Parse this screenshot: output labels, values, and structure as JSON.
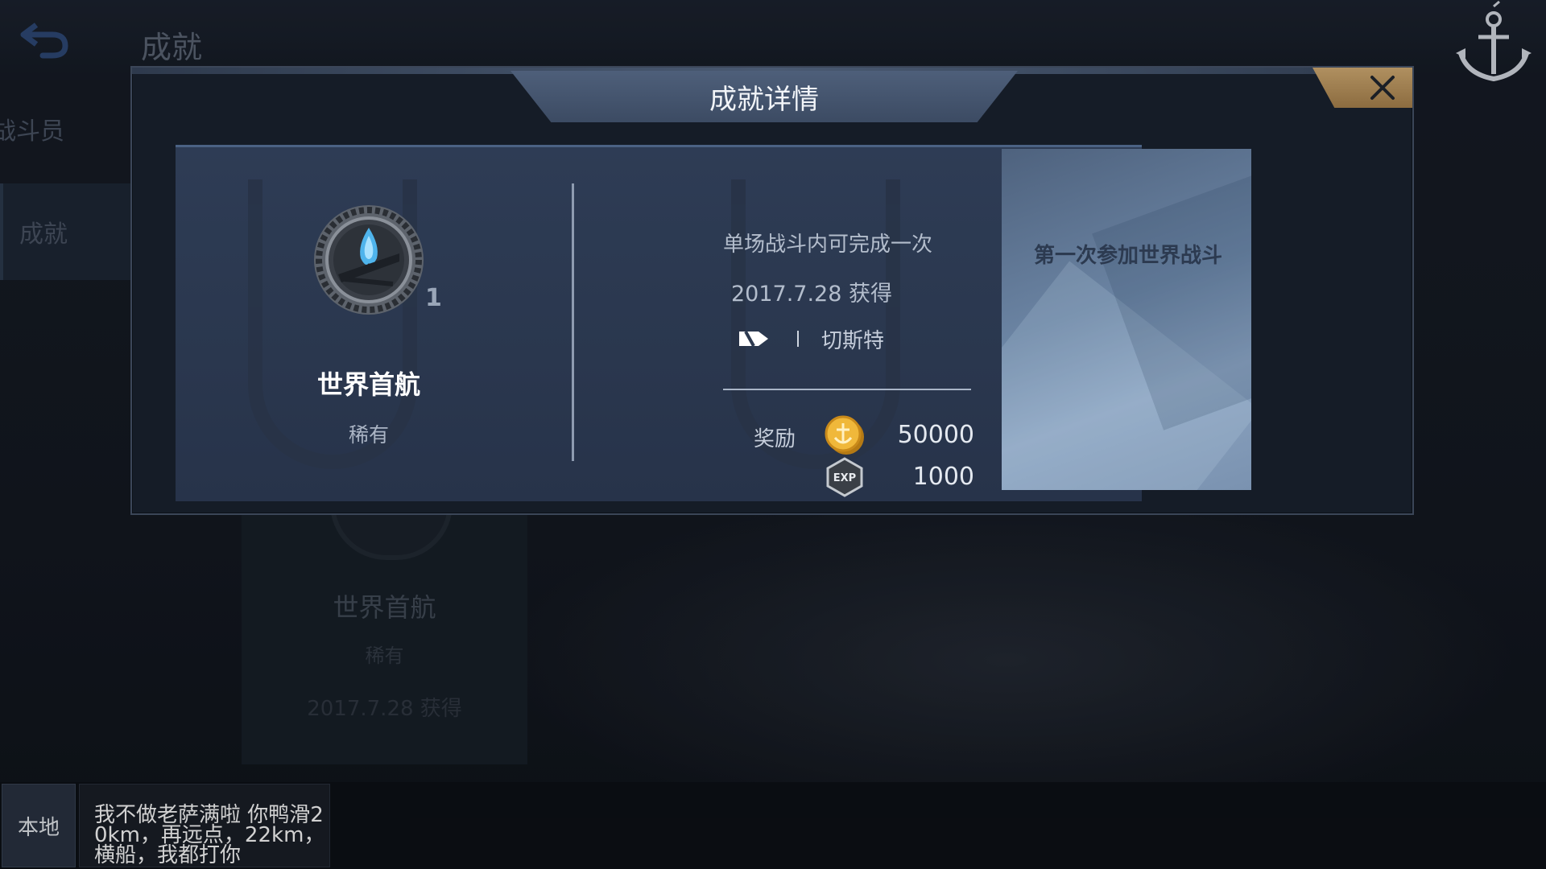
{
  "page": {
    "title": "成就",
    "side_tabs": [
      "战斗员",
      "成就"
    ]
  },
  "background_card": {
    "name": "世界首航",
    "rarity": "稀有",
    "date": "2017.7.28 获得"
  },
  "modal": {
    "title": "成就详情",
    "achievement": {
      "name": "世界首航",
      "rarity": "稀有",
      "count": "1",
      "condition": "单场战斗内可完成一次",
      "obtained_date": "2017.7.28 获得",
      "ship_separator": "|",
      "ship_name": "切斯特",
      "description": "第一次参加世界战斗"
    },
    "rewards": {
      "label": "奖励",
      "items": [
        {
          "icon": "gold-coin-icon",
          "value": "50000"
        },
        {
          "icon": "exp-icon",
          "value": "1000"
        }
      ]
    }
  },
  "chat": {
    "channel": "本地",
    "message": "我不做老萨满啦 你鸭滑20km，再远点，22km，横船，我都打你"
  },
  "colors": {
    "close_button": "#9c7a4c",
    "panel": "#2e3c55",
    "title_tab": "#4e5f7a"
  }
}
